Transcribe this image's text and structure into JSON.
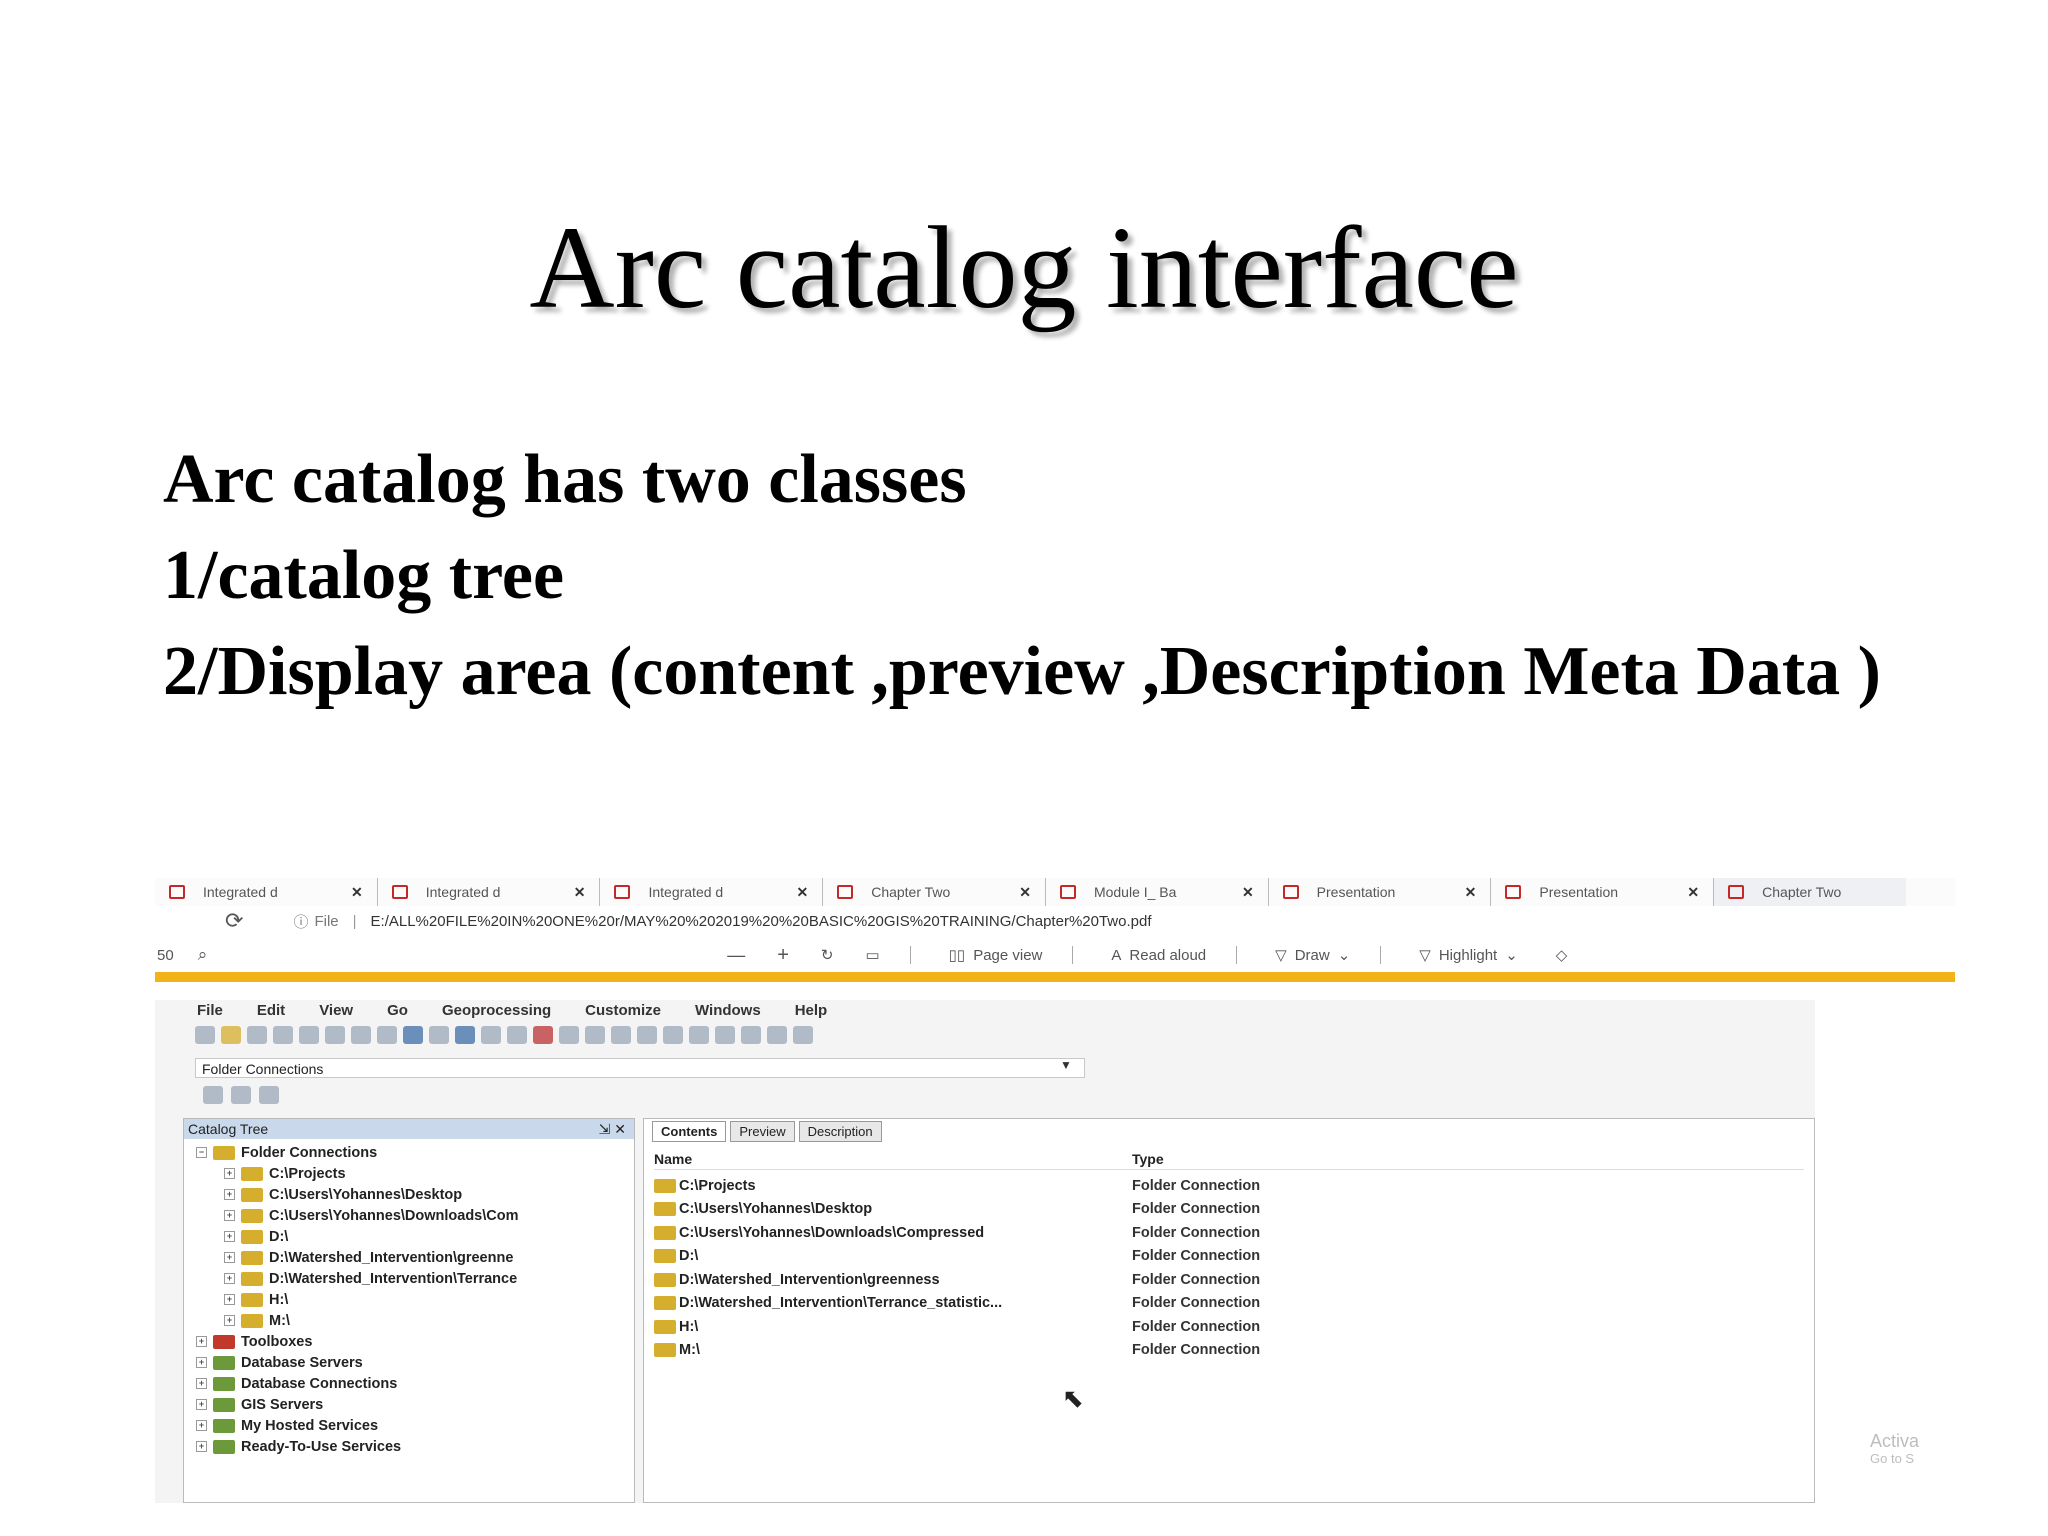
{
  "slide": {
    "title": "Arc catalog interface",
    "lines": [
      "Arc catalog has two classes",
      "1/catalog tree",
      "2/Display area (content ,preview ,Description Meta Data )"
    ]
  },
  "browser": {
    "tabs": [
      {
        "label": "Integrated d"
      },
      {
        "label": "Integrated d"
      },
      {
        "label": "Integrated d"
      },
      {
        "label": "Chapter Two"
      },
      {
        "label": "Module I_ Ba"
      },
      {
        "label": "Presentation"
      },
      {
        "label": "Presentation"
      },
      {
        "label": "Chapter Two"
      }
    ],
    "close_glyph": "✕",
    "file_label": "File",
    "url": "E:/ALL%20FILE%20IN%20ONE%20r/MAY%20%202019%20%20BASIC%20GIS%20TRAINING/Chapter%20Two.pdf",
    "zoom_fragment": "50",
    "toolbar": {
      "page_view": "Page view",
      "read_aloud": "Read aloud",
      "draw": "Draw",
      "highlight": "Highlight"
    }
  },
  "arccatalog": {
    "menu": [
      "File",
      "Edit",
      "View",
      "Go",
      "Geoprocessing",
      "Customize",
      "Windows",
      "Help"
    ],
    "location": "Folder Connections",
    "tree_title": "Catalog Tree",
    "tree": [
      {
        "label": "Folder Connections",
        "level": 0,
        "kind": "folder"
      },
      {
        "label": "C:\\Projects",
        "level": 1,
        "kind": "folder"
      },
      {
        "label": "C:\\Users\\Yohannes\\Desktop",
        "level": 1,
        "kind": "folder"
      },
      {
        "label": "C:\\Users\\Yohannes\\Downloads\\Com",
        "level": 1,
        "kind": "folder"
      },
      {
        "label": "D:\\",
        "level": 1,
        "kind": "folder"
      },
      {
        "label": "D:\\Watershed_Intervention\\greenne",
        "level": 1,
        "kind": "folder"
      },
      {
        "label": "D:\\Watershed_Intervention\\Terrance",
        "level": 1,
        "kind": "folder"
      },
      {
        "label": "H:\\",
        "level": 1,
        "kind": "folder"
      },
      {
        "label": "M:\\",
        "level": 1,
        "kind": "folder"
      },
      {
        "label": "Toolboxes",
        "level": 0,
        "kind": "toolbox"
      },
      {
        "label": "Database Servers",
        "level": 0,
        "kind": "server"
      },
      {
        "label": "Database Connections",
        "level": 0,
        "kind": "server"
      },
      {
        "label": "GIS Servers",
        "level": 0,
        "kind": "server"
      },
      {
        "label": "My Hosted Services",
        "level": 0,
        "kind": "server"
      },
      {
        "label": "Ready-To-Use Services",
        "level": 0,
        "kind": "server"
      }
    ],
    "tabs": [
      "Contents",
      "Preview",
      "Description"
    ],
    "columns": [
      "Name",
      "Type"
    ],
    "rows": [
      {
        "name": "C:\\Projects",
        "type": "Folder Connection"
      },
      {
        "name": "C:\\Users\\Yohannes\\Desktop",
        "type": "Folder Connection"
      },
      {
        "name": "C:\\Users\\Yohannes\\Downloads\\Compressed",
        "type": "Folder Connection"
      },
      {
        "name": "D:\\",
        "type": "Folder Connection"
      },
      {
        "name": "D:\\Watershed_Intervention\\greenness",
        "type": "Folder Connection"
      },
      {
        "name": "D:\\Watershed_Intervention\\Terrance_statistic...",
        "type": "Folder Connection"
      },
      {
        "name": "H:\\",
        "type": "Folder Connection"
      },
      {
        "name": "M:\\",
        "type": "Folder Connection"
      }
    ]
  },
  "watermark": [
    "Activa",
    "Go to S"
  ],
  "colors": {
    "accent": "#f2b319",
    "pdf_icon": "#c62828",
    "tree_header": "#c9d8ea"
  }
}
